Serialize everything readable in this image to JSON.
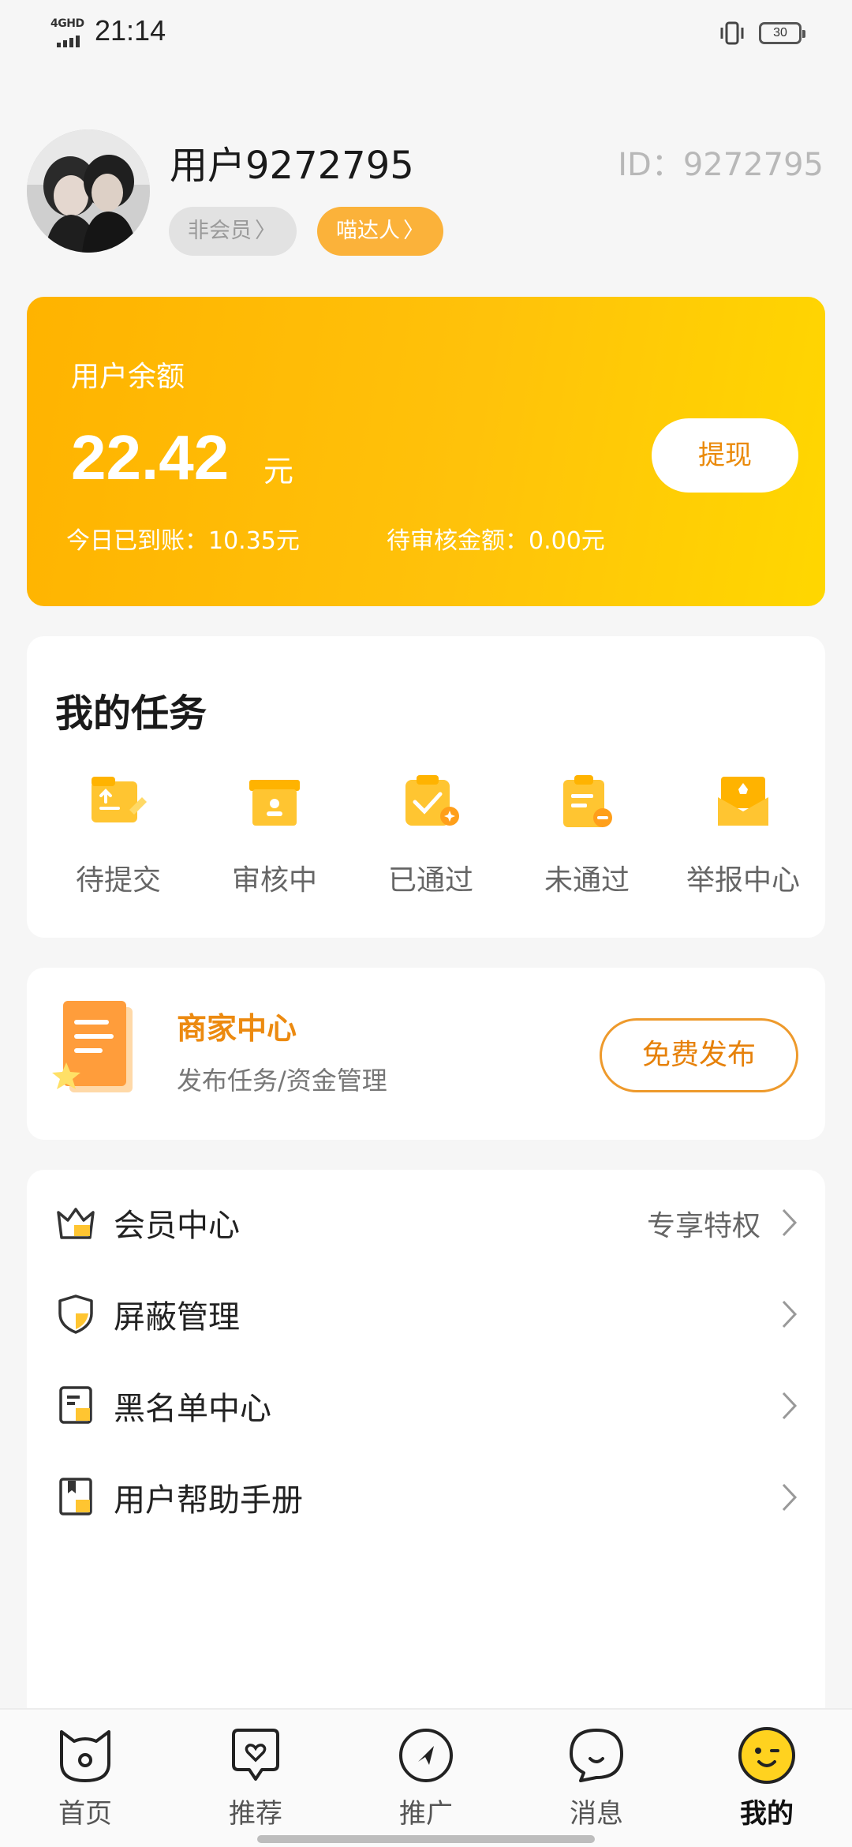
{
  "status_bar": {
    "network": "4GHD",
    "time": "21:14",
    "battery": "30"
  },
  "profile": {
    "username": "用户9272795",
    "id_label": "ID：9272795",
    "member_pill": "非会员",
    "talent_pill": "喵达人"
  },
  "balance": {
    "label": "用户余额",
    "amount": "22.42",
    "unit": "元",
    "withdraw": "提现",
    "today": "今日已到账：10.35元",
    "pending": "待审核金额：0.00元"
  },
  "tasks": {
    "title": "我的任务",
    "items": [
      {
        "label": "待提交",
        "icon": "upload-doc-icon"
      },
      {
        "label": "审核中",
        "icon": "review-box-icon"
      },
      {
        "label": "已通过",
        "icon": "approved-check-icon"
      },
      {
        "label": "未通过",
        "icon": "rejected-clipboard-icon"
      },
      {
        "label": "举报中心",
        "icon": "report-envelope-icon"
      }
    ]
  },
  "merchant": {
    "title": "商家中心",
    "subtitle": "发布任务/资金管理",
    "button": "免费发布"
  },
  "menu": {
    "items": [
      {
        "label": "会员中心",
        "extra": "专享特权",
        "icon": "crown-icon"
      },
      {
        "label": "屏蔽管理",
        "extra": "",
        "icon": "shield-icon"
      },
      {
        "label": "黑名单中心",
        "extra": "",
        "icon": "blacklist-doc-icon"
      },
      {
        "label": "用户帮助手册",
        "extra": "",
        "icon": "help-book-icon"
      }
    ]
  },
  "tabs": [
    {
      "label": "首页",
      "icon": "cat-home-icon"
    },
    {
      "label": "推荐",
      "icon": "heart-bubble-icon"
    },
    {
      "label": "推广",
      "icon": "navigate-icon"
    },
    {
      "label": "消息",
      "icon": "message-icon"
    },
    {
      "label": "我的",
      "icon": "smiley-icon"
    }
  ],
  "colors": {
    "accent_orange": "#fbb23a",
    "balance_gradient_start": "#ffb300",
    "balance_gradient_end": "#ffd700",
    "merchant_text": "#ec8a10"
  }
}
